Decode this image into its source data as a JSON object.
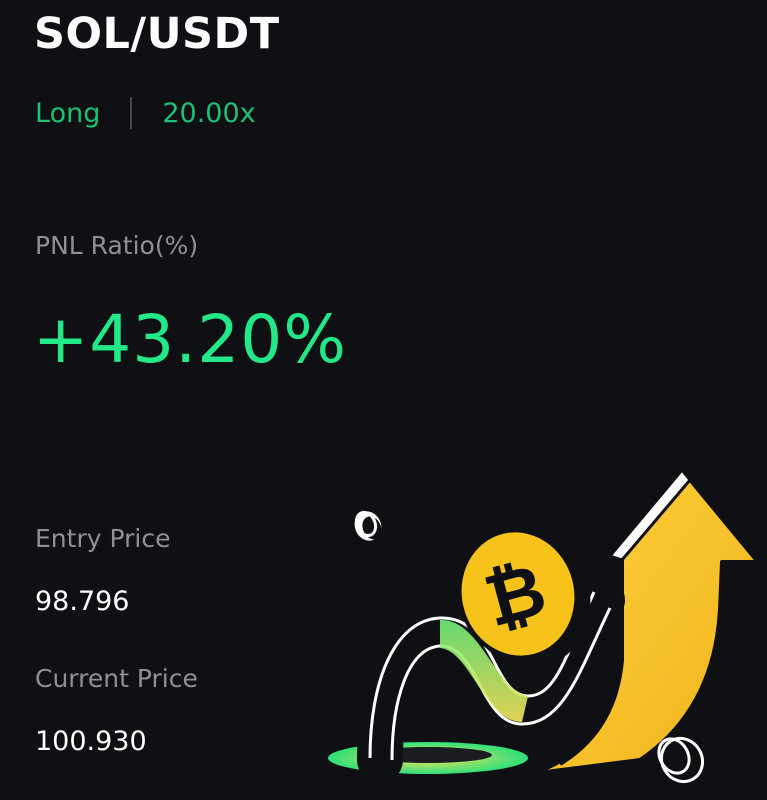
{
  "pair": "SOL/USDT",
  "position": {
    "side": "Long",
    "leverage": "20.00x"
  },
  "pnl": {
    "label": "PNL Ratio(%)",
    "value": "+43.20%"
  },
  "entry": {
    "label": "Entry Price",
    "value": "98.796"
  },
  "current": {
    "label": "Current Price",
    "value": "100.930"
  },
  "illustration": {
    "icons": [
      "bitcoin-coin-icon",
      "up-arrow-icon",
      "coin-icon"
    ]
  },
  "colors": {
    "background": "#0f1013",
    "accent_green": "#1dbf73",
    "pnl_green": "#23e888",
    "label_gray": "#8e9097",
    "bitcoin_yellow": "#f7c21a"
  }
}
